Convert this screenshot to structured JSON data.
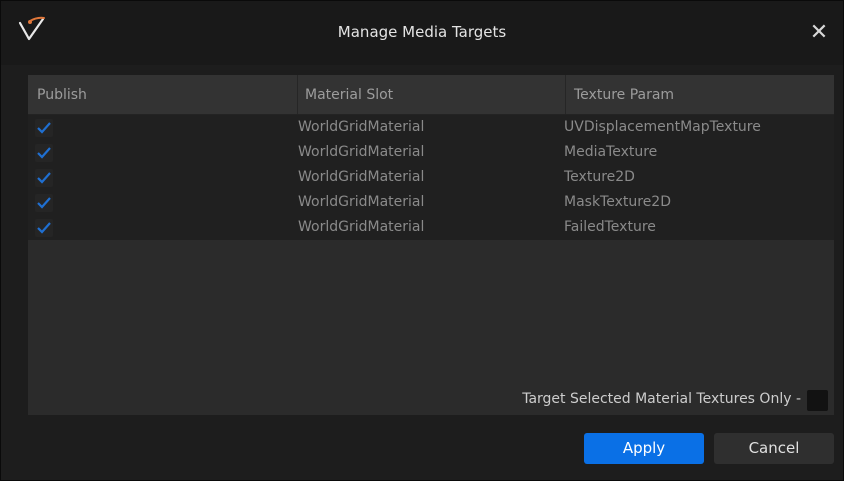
{
  "window": {
    "title": "Manage Media Targets",
    "close_glyph": "✕",
    "logo_icon": "unreal-v-logo-icon"
  },
  "table": {
    "headers": [
      "Publish",
      "Material Slot",
      "Texture Param"
    ],
    "rows": [
      {
        "publish": true,
        "slot": "WorldGridMaterial",
        "param": "UVDisplacementMapTexture"
      },
      {
        "publish": true,
        "slot": "WorldGridMaterial",
        "param": "MediaTexture"
      },
      {
        "publish": true,
        "slot": "WorldGridMaterial",
        "param": "Texture2D"
      },
      {
        "publish": true,
        "slot": "WorldGridMaterial",
        "param": "MaskTexture2D"
      },
      {
        "publish": true,
        "slot": "WorldGridMaterial",
        "param": "FailedTexture"
      }
    ]
  },
  "footer": {
    "target_selected_label": "Target Selected Material Textures Only -",
    "target_selected_checked": false
  },
  "buttons": {
    "apply_label": "Apply",
    "cancel_label": "Cancel"
  },
  "colors": {
    "accent": "#0a70e6",
    "check": "#1f6fd1"
  }
}
